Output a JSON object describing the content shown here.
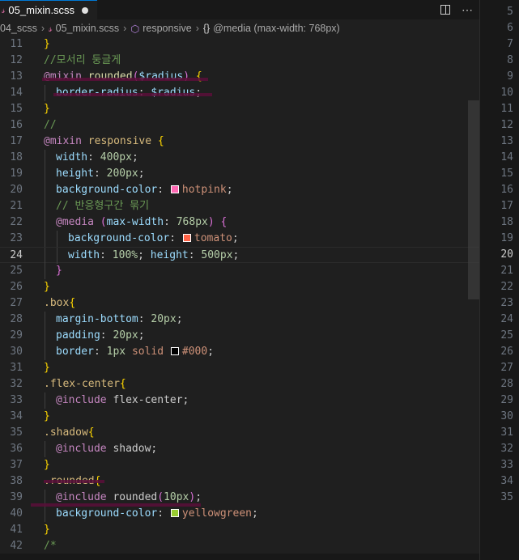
{
  "tab": {
    "filename": "05_mixin.scss",
    "icon": "sass-icon",
    "unsaved": true
  },
  "breadcrumb": [
    "04_scss",
    "05_mixin.scss",
    "responsive",
    "@media (max-width: 768px)"
  ],
  "active_line": 24,
  "lines": [
    {
      "n": 11,
      "indent": 0,
      "tokens": [
        [
          "}",
          "br"
        ]
      ]
    },
    {
      "n": 12,
      "indent": 0,
      "tokens": [
        [
          "//모서리 둥글게",
          "cm"
        ]
      ]
    },
    {
      "n": 13,
      "indent": 0,
      "tokens": [
        [
          "@mixin",
          "kw"
        ],
        [
          " ",
          "pun"
        ],
        [
          "rounded",
          "fn"
        ],
        [
          "(",
          "br2"
        ],
        [
          "$radius",
          "var"
        ],
        [
          ")",
          "br2"
        ],
        [
          " ",
          "pun"
        ],
        [
          "{",
          "br"
        ]
      ]
    },
    {
      "n": 14,
      "indent": 1,
      "tokens": [
        [
          "border-radius",
          "prop"
        ],
        [
          ": ",
          "pun"
        ],
        [
          "$radius",
          "var"
        ],
        [
          ";",
          "pun"
        ]
      ]
    },
    {
      "n": 15,
      "indent": 0,
      "tokens": [
        [
          "}",
          "br"
        ]
      ]
    },
    {
      "n": 16,
      "indent": 0,
      "tokens": [
        [
          "//",
          "cm"
        ]
      ]
    },
    {
      "n": 17,
      "indent": 0,
      "tokens": [
        [
          "@mixin",
          "kw"
        ],
        [
          " ",
          "pun"
        ],
        [
          "responsive",
          "sel"
        ],
        [
          " ",
          "pun"
        ],
        [
          "{",
          "br"
        ]
      ]
    },
    {
      "n": 18,
      "indent": 1,
      "tokens": [
        [
          "width",
          "prop"
        ],
        [
          ": ",
          "pun"
        ],
        [
          "400px",
          "num"
        ],
        [
          ";",
          "pun"
        ]
      ]
    },
    {
      "n": 19,
      "indent": 1,
      "tokens": [
        [
          "height",
          "prop"
        ],
        [
          ": ",
          "pun"
        ],
        [
          "200px",
          "num"
        ],
        [
          ";",
          "pun"
        ]
      ]
    },
    {
      "n": 20,
      "indent": 1,
      "tokens": [
        [
          "background-color",
          "prop"
        ],
        [
          ": ",
          "pun"
        ],
        [
          "swatch:#ff69b4",
          "sw"
        ],
        [
          "hotpink",
          "val"
        ],
        [
          ";",
          "pun"
        ]
      ]
    },
    {
      "n": 21,
      "indent": 1,
      "tokens": [
        [
          "// 반응형구간 묶기",
          "cm"
        ]
      ]
    },
    {
      "n": 22,
      "indent": 1,
      "tokens": [
        [
          "@media",
          "kw"
        ],
        [
          " ",
          "pun"
        ],
        [
          "(",
          "br2"
        ],
        [
          "max-width",
          "prop"
        ],
        [
          ": ",
          "pun"
        ],
        [
          "768px",
          "num"
        ],
        [
          ")",
          "br2"
        ],
        [
          " ",
          "pun"
        ],
        [
          "{",
          "br2"
        ]
      ]
    },
    {
      "n": 23,
      "indent": 2,
      "tokens": [
        [
          "background-color",
          "prop"
        ],
        [
          ": ",
          "pun"
        ],
        [
          "swatch:#ff6347",
          "sw"
        ],
        [
          "tomato",
          "val"
        ],
        [
          ";",
          "pun"
        ]
      ]
    },
    {
      "n": 24,
      "indent": 2,
      "tokens": [
        [
          "width",
          "prop"
        ],
        [
          ": ",
          "pun"
        ],
        [
          "100%",
          "num"
        ],
        [
          ";",
          "pun"
        ],
        [
          " ",
          "pun"
        ],
        [
          "height",
          "prop"
        ],
        [
          ": ",
          "pun"
        ],
        [
          "500px",
          "num"
        ],
        [
          ";",
          "pun"
        ]
      ]
    },
    {
      "n": 25,
      "indent": 1,
      "tokens": [
        [
          "}",
          "br2"
        ]
      ]
    },
    {
      "n": 26,
      "indent": 0,
      "tokens": [
        [
          "}",
          "br"
        ]
      ]
    },
    {
      "n": 27,
      "indent": 0,
      "tokens": [
        [
          ".box",
          "sel"
        ],
        [
          "{",
          "br"
        ]
      ]
    },
    {
      "n": 28,
      "indent": 1,
      "tokens": [
        [
          "margin-bottom",
          "prop"
        ],
        [
          ": ",
          "pun"
        ],
        [
          "20px",
          "num"
        ],
        [
          ";",
          "pun"
        ]
      ]
    },
    {
      "n": 29,
      "indent": 1,
      "tokens": [
        [
          "padding",
          "prop"
        ],
        [
          ": ",
          "pun"
        ],
        [
          "20px",
          "num"
        ],
        [
          ";",
          "pun"
        ]
      ]
    },
    {
      "n": 30,
      "indent": 1,
      "tokens": [
        [
          "border",
          "prop"
        ],
        [
          ": ",
          "pun"
        ],
        [
          "1px",
          "num"
        ],
        [
          " ",
          "pun"
        ],
        [
          "solid",
          "val"
        ],
        [
          " ",
          "pun"
        ],
        [
          "swatch:#000000",
          "sw"
        ],
        [
          "#000",
          "val"
        ],
        [
          ";",
          "pun"
        ]
      ]
    },
    {
      "n": 31,
      "indent": 0,
      "tokens": [
        [
          "}",
          "br"
        ]
      ]
    },
    {
      "n": 32,
      "indent": 0,
      "tokens": [
        [
          ".flex-center",
          "sel"
        ],
        [
          "{",
          "br"
        ]
      ]
    },
    {
      "n": 33,
      "indent": 1,
      "tokens": [
        [
          "@include",
          "kw"
        ],
        [
          " ",
          "pun"
        ],
        [
          "flex-center",
          "pun"
        ],
        [
          ";",
          "pun"
        ]
      ]
    },
    {
      "n": 34,
      "indent": 0,
      "tokens": [
        [
          "}",
          "br"
        ]
      ]
    },
    {
      "n": 35,
      "indent": 0,
      "tokens": [
        [
          ".shadow",
          "sel"
        ],
        [
          "{",
          "br"
        ]
      ]
    },
    {
      "n": 36,
      "indent": 1,
      "tokens": [
        [
          "@include",
          "kw"
        ],
        [
          " ",
          "pun"
        ],
        [
          "shadow",
          "pun"
        ],
        [
          ";",
          "pun"
        ]
      ]
    },
    {
      "n": 37,
      "indent": 0,
      "tokens": [
        [
          "}",
          "br"
        ]
      ]
    },
    {
      "n": 38,
      "indent": 0,
      "tokens": [
        [
          ".rounded",
          "sel"
        ],
        [
          "{",
          "br"
        ]
      ]
    },
    {
      "n": 39,
      "indent": 1,
      "tokens": [
        [
          "@include",
          "kw"
        ],
        [
          " ",
          "pun"
        ],
        [
          "rounded",
          "pun"
        ],
        [
          "(",
          "br2"
        ],
        [
          "10px",
          "num"
        ],
        [
          ")",
          "br2"
        ],
        [
          ";",
          "pun"
        ]
      ]
    },
    {
      "n": 40,
      "indent": 1,
      "tokens": [
        [
          "background-color",
          "prop"
        ],
        [
          ": ",
          "pun"
        ],
        [
          "swatch:#9acd32",
          "sw"
        ],
        [
          "yellowgreen",
          "val"
        ],
        [
          ";",
          "pun"
        ]
      ]
    },
    {
      "n": 41,
      "indent": 0,
      "tokens": [
        [
          "}",
          "br"
        ]
      ]
    },
    {
      "n": 42,
      "indent": 0,
      "tokens": [
        [
          "/*",
          "cm"
        ]
      ]
    }
  ],
  "minimap_numbers": [
    5,
    6,
    7,
    8,
    9,
    10,
    11,
    12,
    13,
    14,
    15,
    16,
    17,
    18,
    19,
    20,
    21,
    22,
    23,
    24,
    25,
    26,
    27,
    28,
    29,
    30,
    31,
    32,
    33,
    34,
    35
  ],
  "minimap_active": 20
}
